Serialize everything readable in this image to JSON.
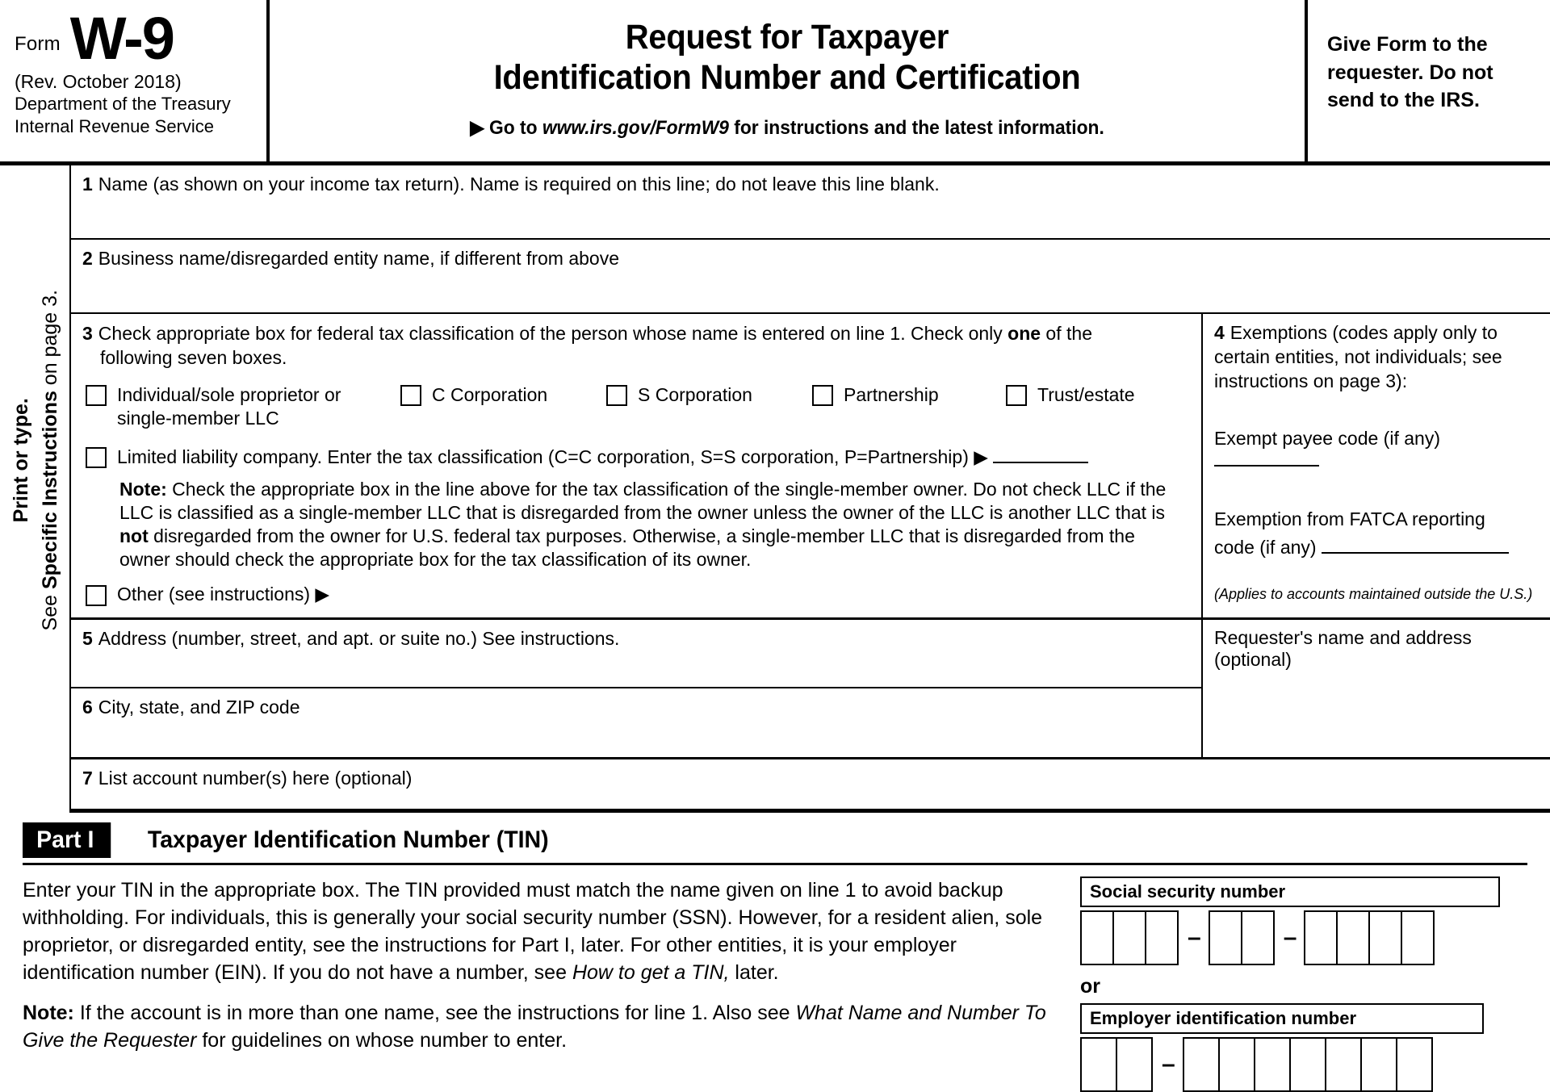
{
  "header": {
    "form_label": "Form",
    "form_number": "W-9",
    "revision": "(Rev. October 2018)",
    "dept_line1": "Department of the Treasury",
    "dept_line2": "Internal Revenue Service",
    "title_line1": "Request for Taxpayer",
    "title_line2": "Identification Number and Certification",
    "goto_prefix": "▶ Go to ",
    "goto_url": "www.irs.gov/FormW9",
    "goto_suffix": " for instructions and the latest information.",
    "right_note": "Give Form to the requester. Do not send to the IRS."
  },
  "sidebar": {
    "line1": "Print or type.",
    "line2_prefix": "See ",
    "line2_bold": "Specific Instructions",
    "line2_suffix": " on page 3."
  },
  "line1": {
    "number": "1",
    "label": "Name (as shown on your income tax return). Name is required on this line; do not leave this line blank."
  },
  "line2": {
    "number": "2",
    "label": "Business name/disregarded entity name, if different from above"
  },
  "line3": {
    "number": "3",
    "head_part1": "Check appropriate box for federal tax classification of the person whose name is entered on line 1. Check only ",
    "head_bold": "one",
    "head_part2": " of the",
    "head_line2": "following seven boxes.",
    "checkboxes": [
      {
        "label_line1": "Individual/sole proprietor or",
        "label_line2": "single-member LLC"
      },
      {
        "label_line1": "C Corporation",
        "label_line2": ""
      },
      {
        "label_line1": "S Corporation",
        "label_line2": ""
      },
      {
        "label_line1": "Partnership",
        "label_line2": ""
      },
      {
        "label_line1": "Trust/estate",
        "label_line2": ""
      }
    ],
    "llc_label": "Limited liability company. Enter the tax classification (C=C corporation, S=S corporation, P=Partnership) ▶",
    "note_bold": "Note:",
    "note_text": " Check the appropriate box in the line above for the tax classification of the single-member owner.  Do not check LLC if the LLC is classified as a single-member LLC that is disregarded from the owner unless the owner of the LLC is another LLC that is ",
    "note_bold2": "not",
    "note_text2": " disregarded from the owner for U.S. federal tax purposes. Otherwise, a single-member LLC that is disregarded from the owner should check the appropriate box for the tax classification of its owner.",
    "other_label": "Other (see instructions) ▶"
  },
  "line4": {
    "number": "4",
    "head": "Exemptions (codes apply only to certain entities, not individuals; see instructions on page 3):",
    "exempt_payee": "Exempt payee code (if any)",
    "fatca_line1": "Exemption from FATCA reporting",
    "fatca_line2": "code (if any)",
    "applies": "(Applies to accounts maintained outside the U.S.)"
  },
  "line5": {
    "number": "5",
    "label": "Address (number, street, and apt. or suite no.) See instructions."
  },
  "line6": {
    "number": "6",
    "label": "City, state, and ZIP code"
  },
  "line7": {
    "number": "7",
    "label": "List account number(s) here (optional)"
  },
  "requester": {
    "label": "Requester's name and address (optional)"
  },
  "part1": {
    "badge": "Part I",
    "title": "Taxpayer Identification Number (TIN)",
    "body_1": "Enter your TIN in the appropriate box. The TIN provided must match the name given on line 1 to avoid backup withholding. For individuals, this is generally your social security number (SSN). However, for a resident alien, sole proprietor, or disregarded entity, see the instructions for Part I, later. For other entities, it is your employer identification number (EIN). If you do not have a number, see ",
    "body_1_italic": "How to get a TIN,",
    "body_1_tail": " later.",
    "note_bold": "Note:",
    "note_text": " If the account is in more than one name, see the instructions for line 1. Also see ",
    "note_italic": "What Name and Number To Give the Requester",
    "note_tail": " for guidelines on whose number to enter.",
    "ssn_label": "Social security number",
    "or_label": "or",
    "ein_label": "Employer identification number",
    "ssn_groups": [
      3,
      2,
      4
    ],
    "ein_groups": [
      2,
      7
    ],
    "separator": "–"
  }
}
